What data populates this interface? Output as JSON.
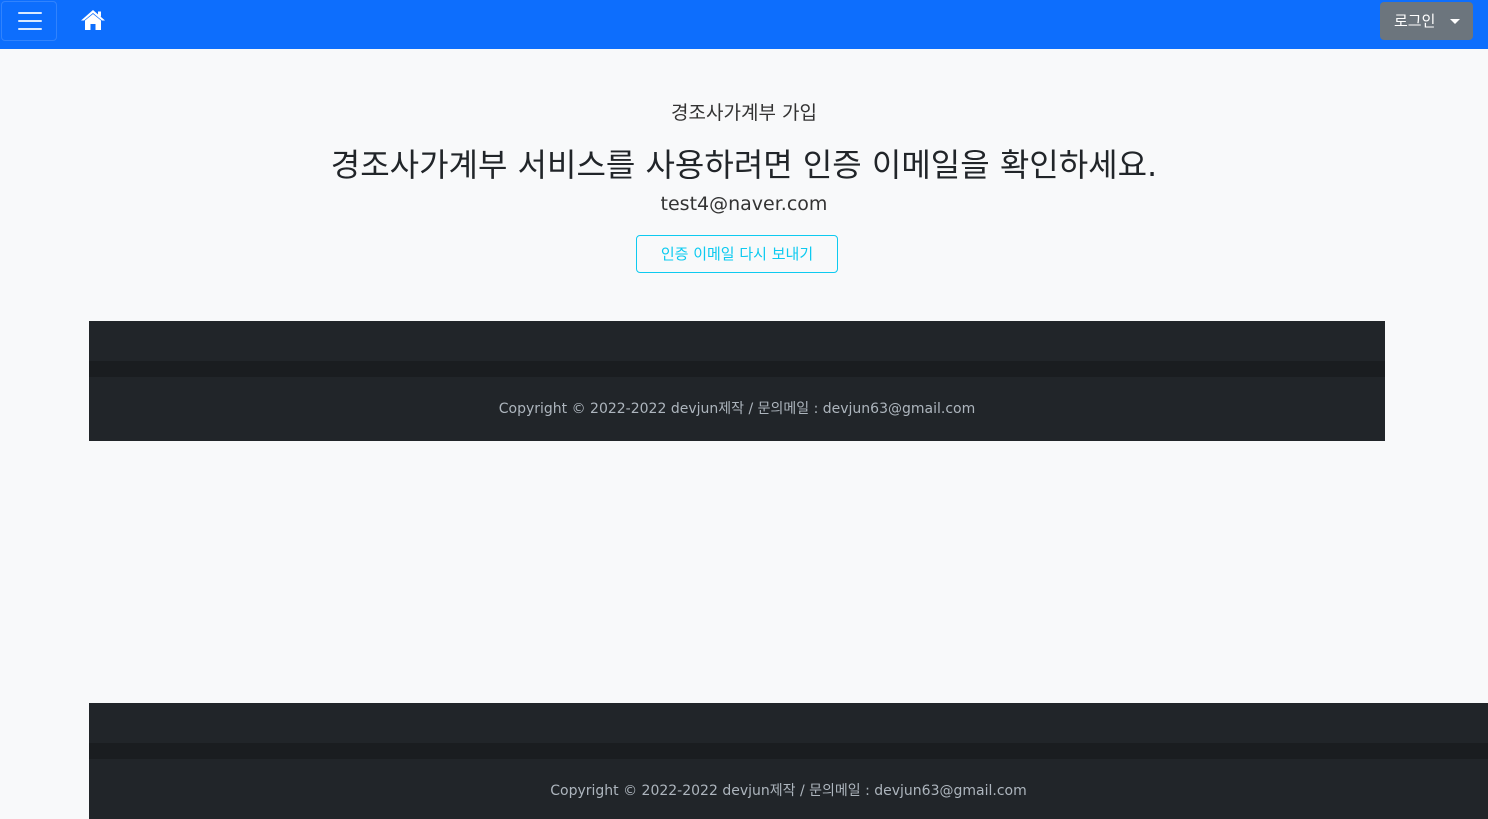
{
  "navbar": {
    "menu_icon": "hamburger-icon",
    "home_icon": "home-icon",
    "login_label": "로그인",
    "login_caret_icon": "caret-down-icon",
    "accent_color": "#0d6efd"
  },
  "main": {
    "subtitle": "경조사가계부 가입",
    "headline": "경조사가계부 서비스를 사용하려면 인증 이메일을 확인하세요.",
    "email": "test4@naver.com",
    "resend_button_label": "인증 이메일 다시 보내기"
  },
  "footer": {
    "copyright": "Copyright © 2022-2022 devjun제작 / 문의메일 : devjun63@gmail.com"
  },
  "footer_bottom": {
    "copyright": "Copyright © 2022-2022 devjun제작 / 문의메일 : devjun63@gmail.com"
  }
}
